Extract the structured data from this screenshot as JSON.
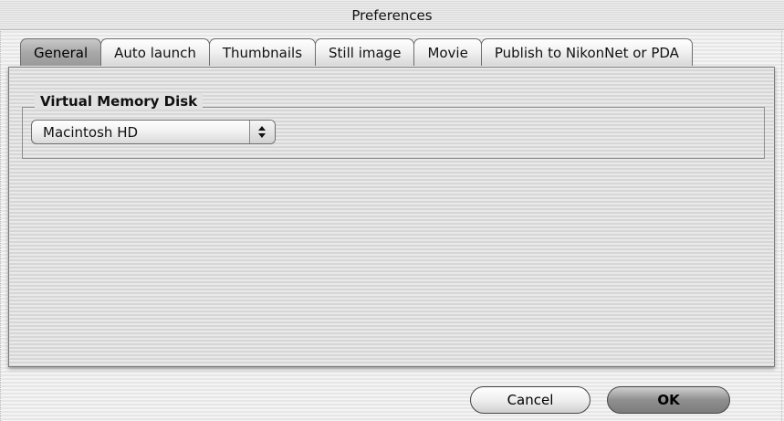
{
  "window": {
    "title": "Preferences"
  },
  "tabs": [
    {
      "label": "General",
      "selected": true
    },
    {
      "label": "Auto launch",
      "selected": false
    },
    {
      "label": "Thumbnails",
      "selected": false
    },
    {
      "label": "Still image",
      "selected": false
    },
    {
      "label": "Movie",
      "selected": false
    },
    {
      "label": "Publish to NikonNet or PDA",
      "selected": false
    }
  ],
  "general": {
    "group_title": "Virtual Memory Disk",
    "disk_select": {
      "value": "Macintosh HD",
      "icon": "updown-arrows-icon"
    }
  },
  "buttons": {
    "cancel_label": "Cancel",
    "ok_label": "OK"
  }
}
